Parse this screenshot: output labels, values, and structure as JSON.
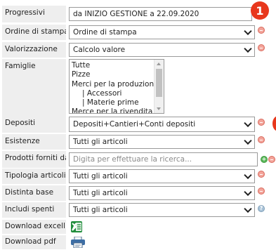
{
  "form": {
    "progressivi": {
      "label": "Progressivi",
      "value": "da INIZIO GESTIONE a 22.09.2020"
    },
    "ordine": {
      "label": "Ordine di stampa",
      "value": "Ordine di stampa"
    },
    "valorizzazione": {
      "label": "Valorizzazione",
      "value": "Calcolo valore"
    },
    "famiglie": {
      "label": "Famiglie",
      "items": [
        "Tutte",
        "Pizze",
        "Merci per la produzione",
        "| Accessori",
        "| Materie prime",
        "Merce per la rivendita"
      ]
    },
    "depositi": {
      "label": "Depositi",
      "value": "Depositi+Cantieri+Conti depositi"
    },
    "esistenze": {
      "label": "Esistenze",
      "value": "Tutti gli articoli"
    },
    "prodotti": {
      "label": "Prodotti forniti da",
      "placeholder": "Digita per effettuare la ricerca..."
    },
    "tipologia": {
      "label": "Tipologia articoli",
      "value": "Tutti gli articoli"
    },
    "distinta": {
      "label": "Distinta base",
      "value": "Tutti gli articoli"
    },
    "includi": {
      "label": "Includi spenti",
      "value": "Tutti gli articoli"
    },
    "download_excel": {
      "label": "Download excell",
      "icon": "excel-icon"
    },
    "download_pdf": {
      "label": "Download pdf",
      "icon": "printer-icon"
    }
  },
  "annotation": {
    "badge_number": "1"
  },
  "colors": {
    "label_bg": "#eeeeee",
    "badge": "#e8371c",
    "remove": "#f3a49a",
    "add": "#5cb85c",
    "help": "#a9c3d8"
  }
}
